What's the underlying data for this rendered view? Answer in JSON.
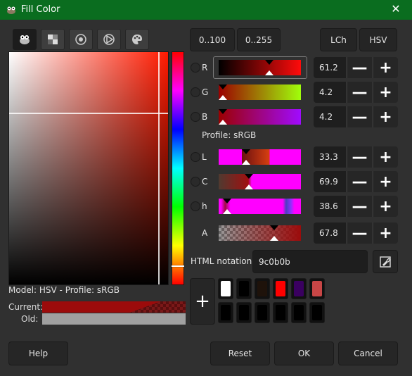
{
  "window": {
    "title": "Fill Color",
    "close_glyph": "✕",
    "icon": "gimp-icon"
  },
  "selectors": [
    {
      "icon": "gimp-wilber-icon",
      "active": true
    },
    {
      "icon": "cmyk-icon",
      "active": false
    },
    {
      "icon": "watercolor-icon",
      "active": false
    },
    {
      "icon": "triangle-wheel-icon",
      "active": false
    },
    {
      "icon": "palette-icon",
      "active": false
    }
  ],
  "color_area": {
    "hue_hex": "#ff1a00"
  },
  "model_label": "Model: HSV - Profile: sRGB",
  "current_label": "Current:",
  "old_label": "Old:",
  "range_buttons": {
    "r100": "0..100",
    "r255": "0..255",
    "lch": "LCh",
    "hsv": "HSV"
  },
  "channels": [
    {
      "label": "R",
      "value": "61.2"
    },
    {
      "label": "G",
      "value": "4.2"
    },
    {
      "label": "B",
      "value": "4.2"
    },
    {
      "label": "L",
      "value": "33.3"
    },
    {
      "label": "C",
      "value": "69.9"
    },
    {
      "label": "h",
      "value": "38.6"
    },
    {
      "label": "A",
      "value": "67.8"
    }
  ],
  "step_buttons": {
    "minus": "—",
    "plus": "+"
  },
  "profile_label": "Profile: sRGB",
  "html_notation": {
    "label": "HTML notation:",
    "value": "9c0b0b"
  },
  "add_glyph": "+",
  "history": [
    "#ffffff",
    "#000000",
    "#1e120a",
    "#ff0000",
    "#3a0060",
    "#c84646",
    "#000000",
    "#000000",
    "#000000",
    "#000000",
    "#000000",
    "#000000"
  ],
  "buttons": {
    "help": "Help",
    "reset": "Reset",
    "ok": "OK",
    "cancel": "Cancel"
  }
}
